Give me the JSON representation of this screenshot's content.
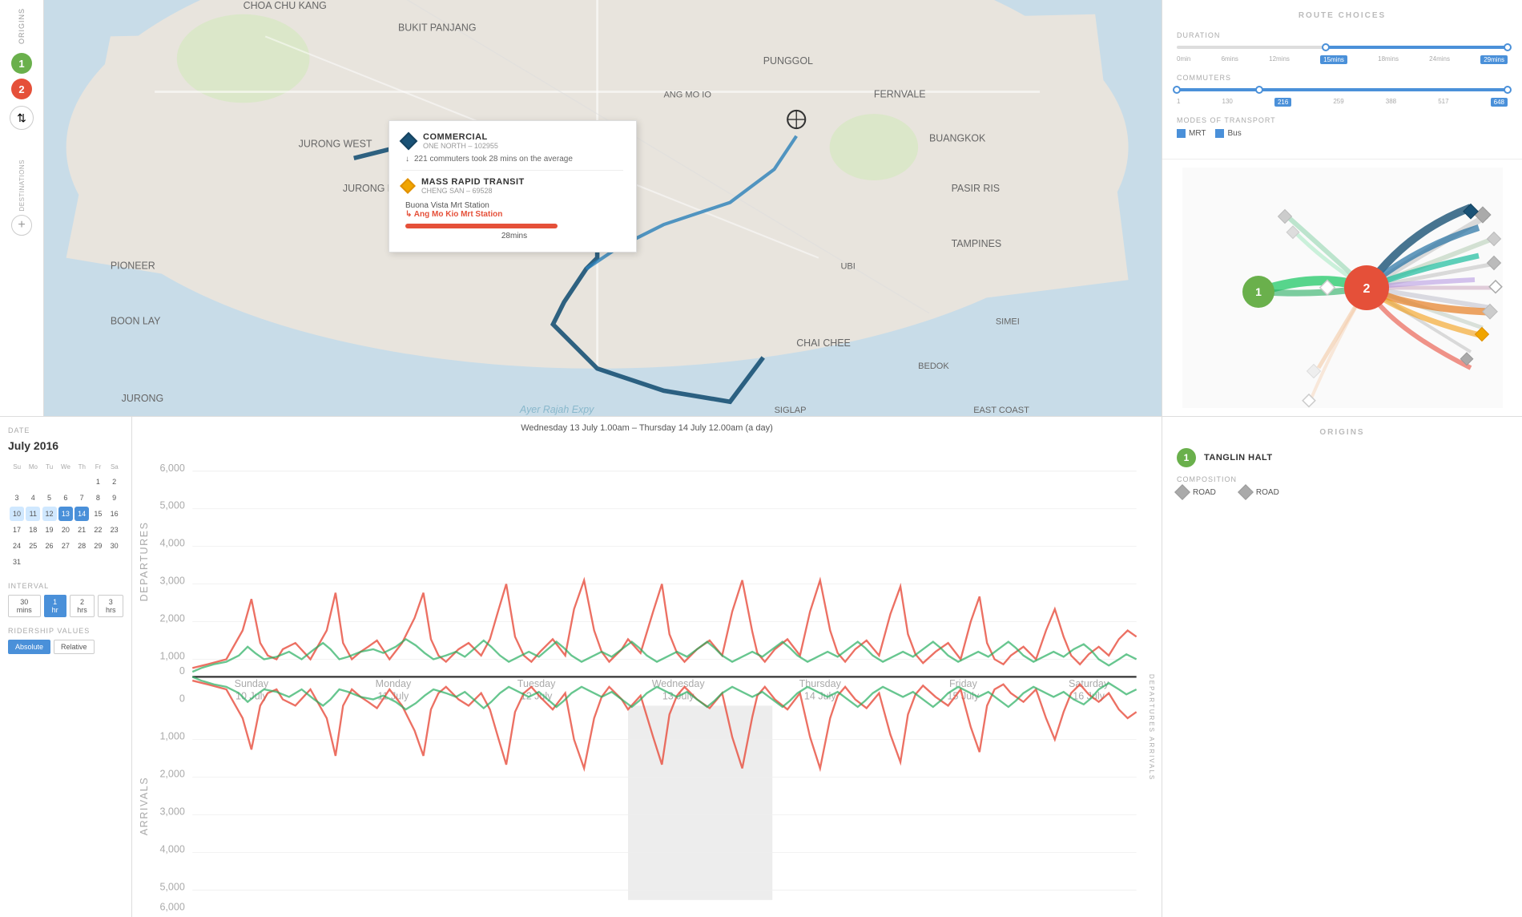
{
  "sidebar": {
    "origins_label": "ORIGINS",
    "destinations_label": "DESTINATIONS",
    "origin1": "1",
    "origin2": "2",
    "swap_icon": "⇅",
    "add_icon": "+"
  },
  "tooltip": {
    "dest_name": "COMMERCIAL",
    "dest_sub": "ONE NORTH – 102955",
    "commuters_text": "221 commuters took 28 mins on the average",
    "origin_name": "MASS RAPID TRANSIT",
    "origin_sub": "CHENG SAN – 69528",
    "route_from": "Buona Vista Mrt Station",
    "route_to": "↳ Ang Mo Kio Mrt Station",
    "route_time": "28mins"
  },
  "right_panel": {
    "title": "ROUTE CHOICES",
    "duration_label": "DURATION",
    "duration_min": "0min",
    "duration_marks": [
      "6mins",
      "12mins",
      "15mins",
      "18mins",
      "24mins",
      "29mins"
    ],
    "duration_selected_start": "15mins",
    "duration_selected_end": "29mins",
    "commuters_label": "COMMUTERS",
    "commuters_min": "1",
    "commuters_marks": [
      "130",
      "216",
      "259",
      "388",
      "517",
      "648"
    ],
    "commuters_selected": "216",
    "modes_label": "MODES OF TRANSPORT",
    "mode_mrt": "MRT",
    "mode_bus": "Bus"
  },
  "bottom_left": {
    "date_label": "DATE",
    "month": "July 2016",
    "calendar": {
      "headers": [
        "Su",
        "Mo",
        "Tu",
        "We",
        "Th",
        "Fr",
        "Sa"
      ],
      "weeks": [
        [
          "",
          "",
          "",
          "",
          "",
          "1",
          "2"
        ],
        [
          "3",
          "4",
          "5",
          "6",
          "7",
          "8",
          "9"
        ],
        [
          "10",
          "11",
          "12",
          "13",
          "14",
          "15",
          "16"
        ],
        [
          "17",
          "18",
          "19",
          "20",
          "21",
          "22",
          "23"
        ],
        [
          "24",
          "25",
          "26",
          "27",
          "28",
          "29",
          "30"
        ],
        [
          "31",
          "",
          "",
          "",
          "",
          "",
          ""
        ]
      ],
      "selected": [
        "13",
        "14"
      ],
      "highlighted": [
        "10",
        "11",
        "12"
      ]
    },
    "interval_label": "INTERVAL",
    "intervals": [
      "30 mins",
      "1 hr",
      "2 hrs",
      "3 hrs"
    ],
    "interval_active": "1 hr",
    "ridership_label": "RIDERSHIP VALUES",
    "ridership_options": [
      "Absolute",
      "Relative"
    ],
    "ridership_active": "Absolute"
  },
  "chart": {
    "title": "Wednesday 13 July 1.00am – Thursday 14 July 12.00am (a day)",
    "departures_label": "DEPARTURES",
    "arrivals_label": "ARRIVALS",
    "x_labels": [
      "Sunday\n10 July",
      "Monday\n11 July",
      "Tuesday\n12 July",
      "Wednesday\n13 July",
      "Thursday\n14 July",
      "Friday\n15 July",
      "Saturday\n16 July"
    ],
    "y_max_departures": 6000,
    "y_marks_departures": [
      "6,000",
      "5,000",
      "4,000",
      "3,000",
      "2,000",
      "1,000",
      "0"
    ],
    "y_marks_arrivals": [
      "0",
      "1,000",
      "2,000",
      "3,000",
      "4,000",
      "5,000",
      "6,000"
    ]
  },
  "origins_panel": {
    "title": "ORIGINS",
    "items": [
      {
        "num": "1",
        "name": "TANGLIN HALT",
        "composition_label": "COMPOSITION",
        "items": [
          {
            "type": "ROAD",
            "color": "#aaa"
          },
          {
            "type": "ROAD",
            "color": "#aaa"
          }
        ]
      }
    ]
  },
  "accent_color": "#4a90d9",
  "origin_green": "#6ab04c",
  "origin_red": "#e55039"
}
